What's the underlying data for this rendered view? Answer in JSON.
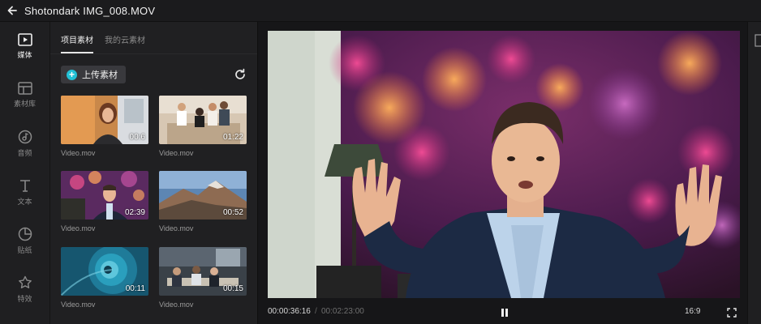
{
  "window": {
    "title": "Shotondark IMG_008.MOV"
  },
  "nav": {
    "items": [
      {
        "label": "媒体",
        "icon": "media-play-icon",
        "active": true
      },
      {
        "label": "素材库",
        "icon": "library-grid-icon",
        "active": false
      },
      {
        "label": "音频",
        "icon": "music-note-icon",
        "active": false
      },
      {
        "label": "文本",
        "icon": "text-t-icon",
        "active": false
      },
      {
        "label": "贴纸",
        "icon": "sticker-icon",
        "active": false
      },
      {
        "label": "特效",
        "icon": "effects-star-icon",
        "active": false
      }
    ]
  },
  "media_panel": {
    "tabs": [
      {
        "label": "项目素材",
        "active": true
      },
      {
        "label": "我的云素材",
        "active": false
      }
    ],
    "upload_label": "上传素材",
    "clips": [
      {
        "name": "Video.mov",
        "duration": "00:06",
        "duration_visible": "00:6"
      },
      {
        "name": "Video.mov",
        "duration": "01:22",
        "duration_visible": "01:22"
      },
      {
        "name": "Video.mov",
        "duration": "02:39",
        "duration_visible": "02:39"
      },
      {
        "name": "Video.mov",
        "duration": "00:52",
        "duration_visible": "00:52"
      },
      {
        "name": "Video.mov",
        "duration": "00:11",
        "duration_visible": "00:11"
      },
      {
        "name": "Video.mov",
        "duration": "00:15",
        "duration_visible": "00:15"
      }
    ]
  },
  "player": {
    "current_time": "00:00:36:16",
    "separator": "/",
    "total_time": "00:02:23:00",
    "aspect_ratio": "16:9"
  },
  "colors": {
    "accent": "#22c1d6",
    "bg": "#1b1b1d",
    "panel": "#202022"
  }
}
